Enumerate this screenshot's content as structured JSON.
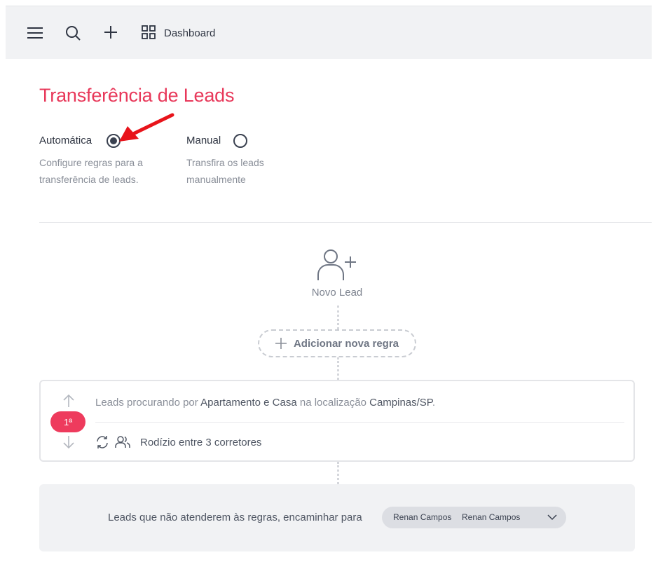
{
  "header": {
    "dashboard_label": "Dashboard",
    "icons": [
      "menu-icon",
      "search-icon",
      "plus-icon",
      "grid-icon"
    ]
  },
  "page": {
    "title": "Transferência de Leads"
  },
  "modes": {
    "automatic": {
      "label": "Automática",
      "description": "Configure regras para a transferência de leads.",
      "selected": true
    },
    "manual": {
      "label": "Manual",
      "description": "Transfira os leads manualmente",
      "selected": false
    }
  },
  "flow": {
    "start_label": "Novo Lead",
    "add_rule_label": "Adicionar nova regra"
  },
  "rules": [
    {
      "rank": "1ª",
      "text_prefix": "Leads procurando por ",
      "property_types": "Apartamento e Casa",
      "text_middle": " na localização ",
      "location": "Campinas/SP",
      "text_suffix": ".",
      "distribution": "Rodízio entre 3 corretores"
    }
  ],
  "fallback": {
    "text": "Leads que não atenderem às regras, encaminhar para",
    "selected_first": "Renan Campos",
    "selected_second": "Renan Campos"
  },
  "colors": {
    "accent": "#e8385a",
    "badge": "#ee3b5d",
    "annotation_arrow": "#e8141b"
  }
}
